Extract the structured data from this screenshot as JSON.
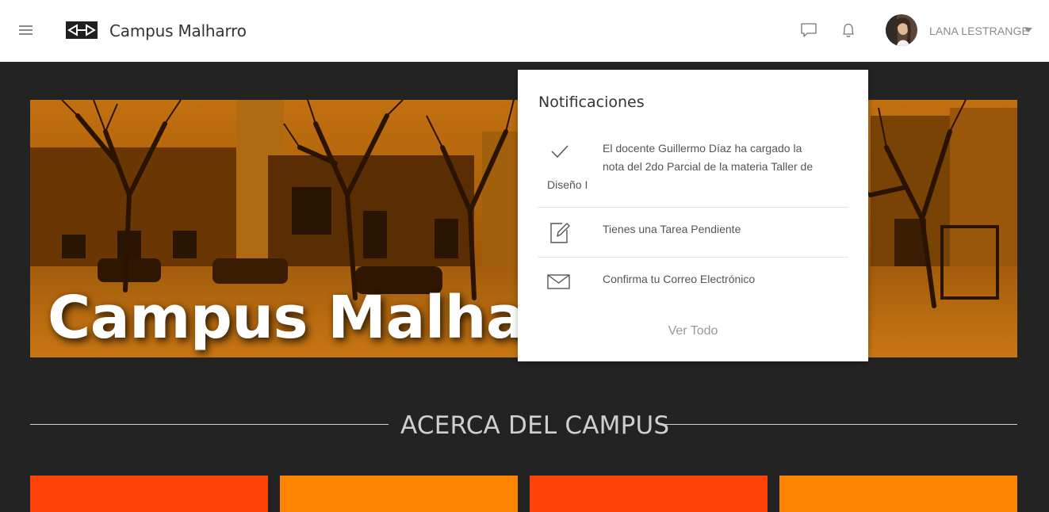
{
  "header": {
    "app_title": "Campus Malharro",
    "user_name": "LANA LESTRANGE"
  },
  "banner": {
    "title": "Campus Malharro"
  },
  "section": {
    "title": "ACERCA DEL CAMPUS"
  },
  "notifications": {
    "heading": "Notificaciones",
    "items": [
      {
        "icon": "check-icon",
        "text_line1": "El docente Guillermo Díaz ha cargado la",
        "text_line2": "nota del 2do Parcial de la materia Taller de",
        "text_line3": "Diseño I"
      },
      {
        "icon": "edit-icon",
        "text": "Tienes una Tarea Pendiente"
      },
      {
        "icon": "envelope-icon",
        "text": "Confirma tu Correo Electrónico"
      }
    ],
    "see_all": "Ver Todo"
  },
  "colors": {
    "card_red": "#ff4208",
    "card_orange": "#ff8400",
    "page_bg": "#232323"
  }
}
